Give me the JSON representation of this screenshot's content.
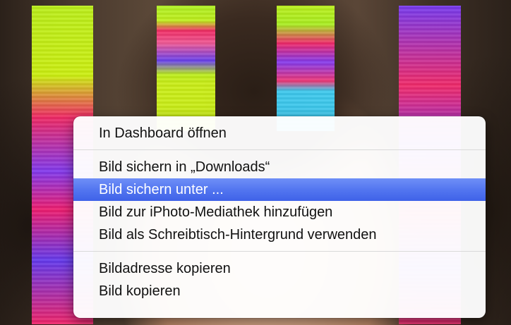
{
  "menu": {
    "sections": [
      {
        "items": [
          {
            "label": "In Dashboard öffnen",
            "highlighted": false
          }
        ]
      },
      {
        "items": [
          {
            "label": "Bild sichern in „Downloads“",
            "highlighted": false
          },
          {
            "label": "Bild sichern unter ...",
            "highlighted": true
          },
          {
            "label": "Bild zur iPhoto-Mediathek hinzufügen",
            "highlighted": false
          },
          {
            "label": "Bild als Schreibtisch-Hintergrund verwenden",
            "highlighted": false
          }
        ]
      },
      {
        "items": [
          {
            "label": "Bildadresse kopieren",
            "highlighted": false
          },
          {
            "label": "Bild kopieren",
            "highlighted": false
          }
        ]
      }
    ]
  },
  "colors": {
    "highlight": "#5376f0",
    "menu_background": "#ffffff"
  }
}
